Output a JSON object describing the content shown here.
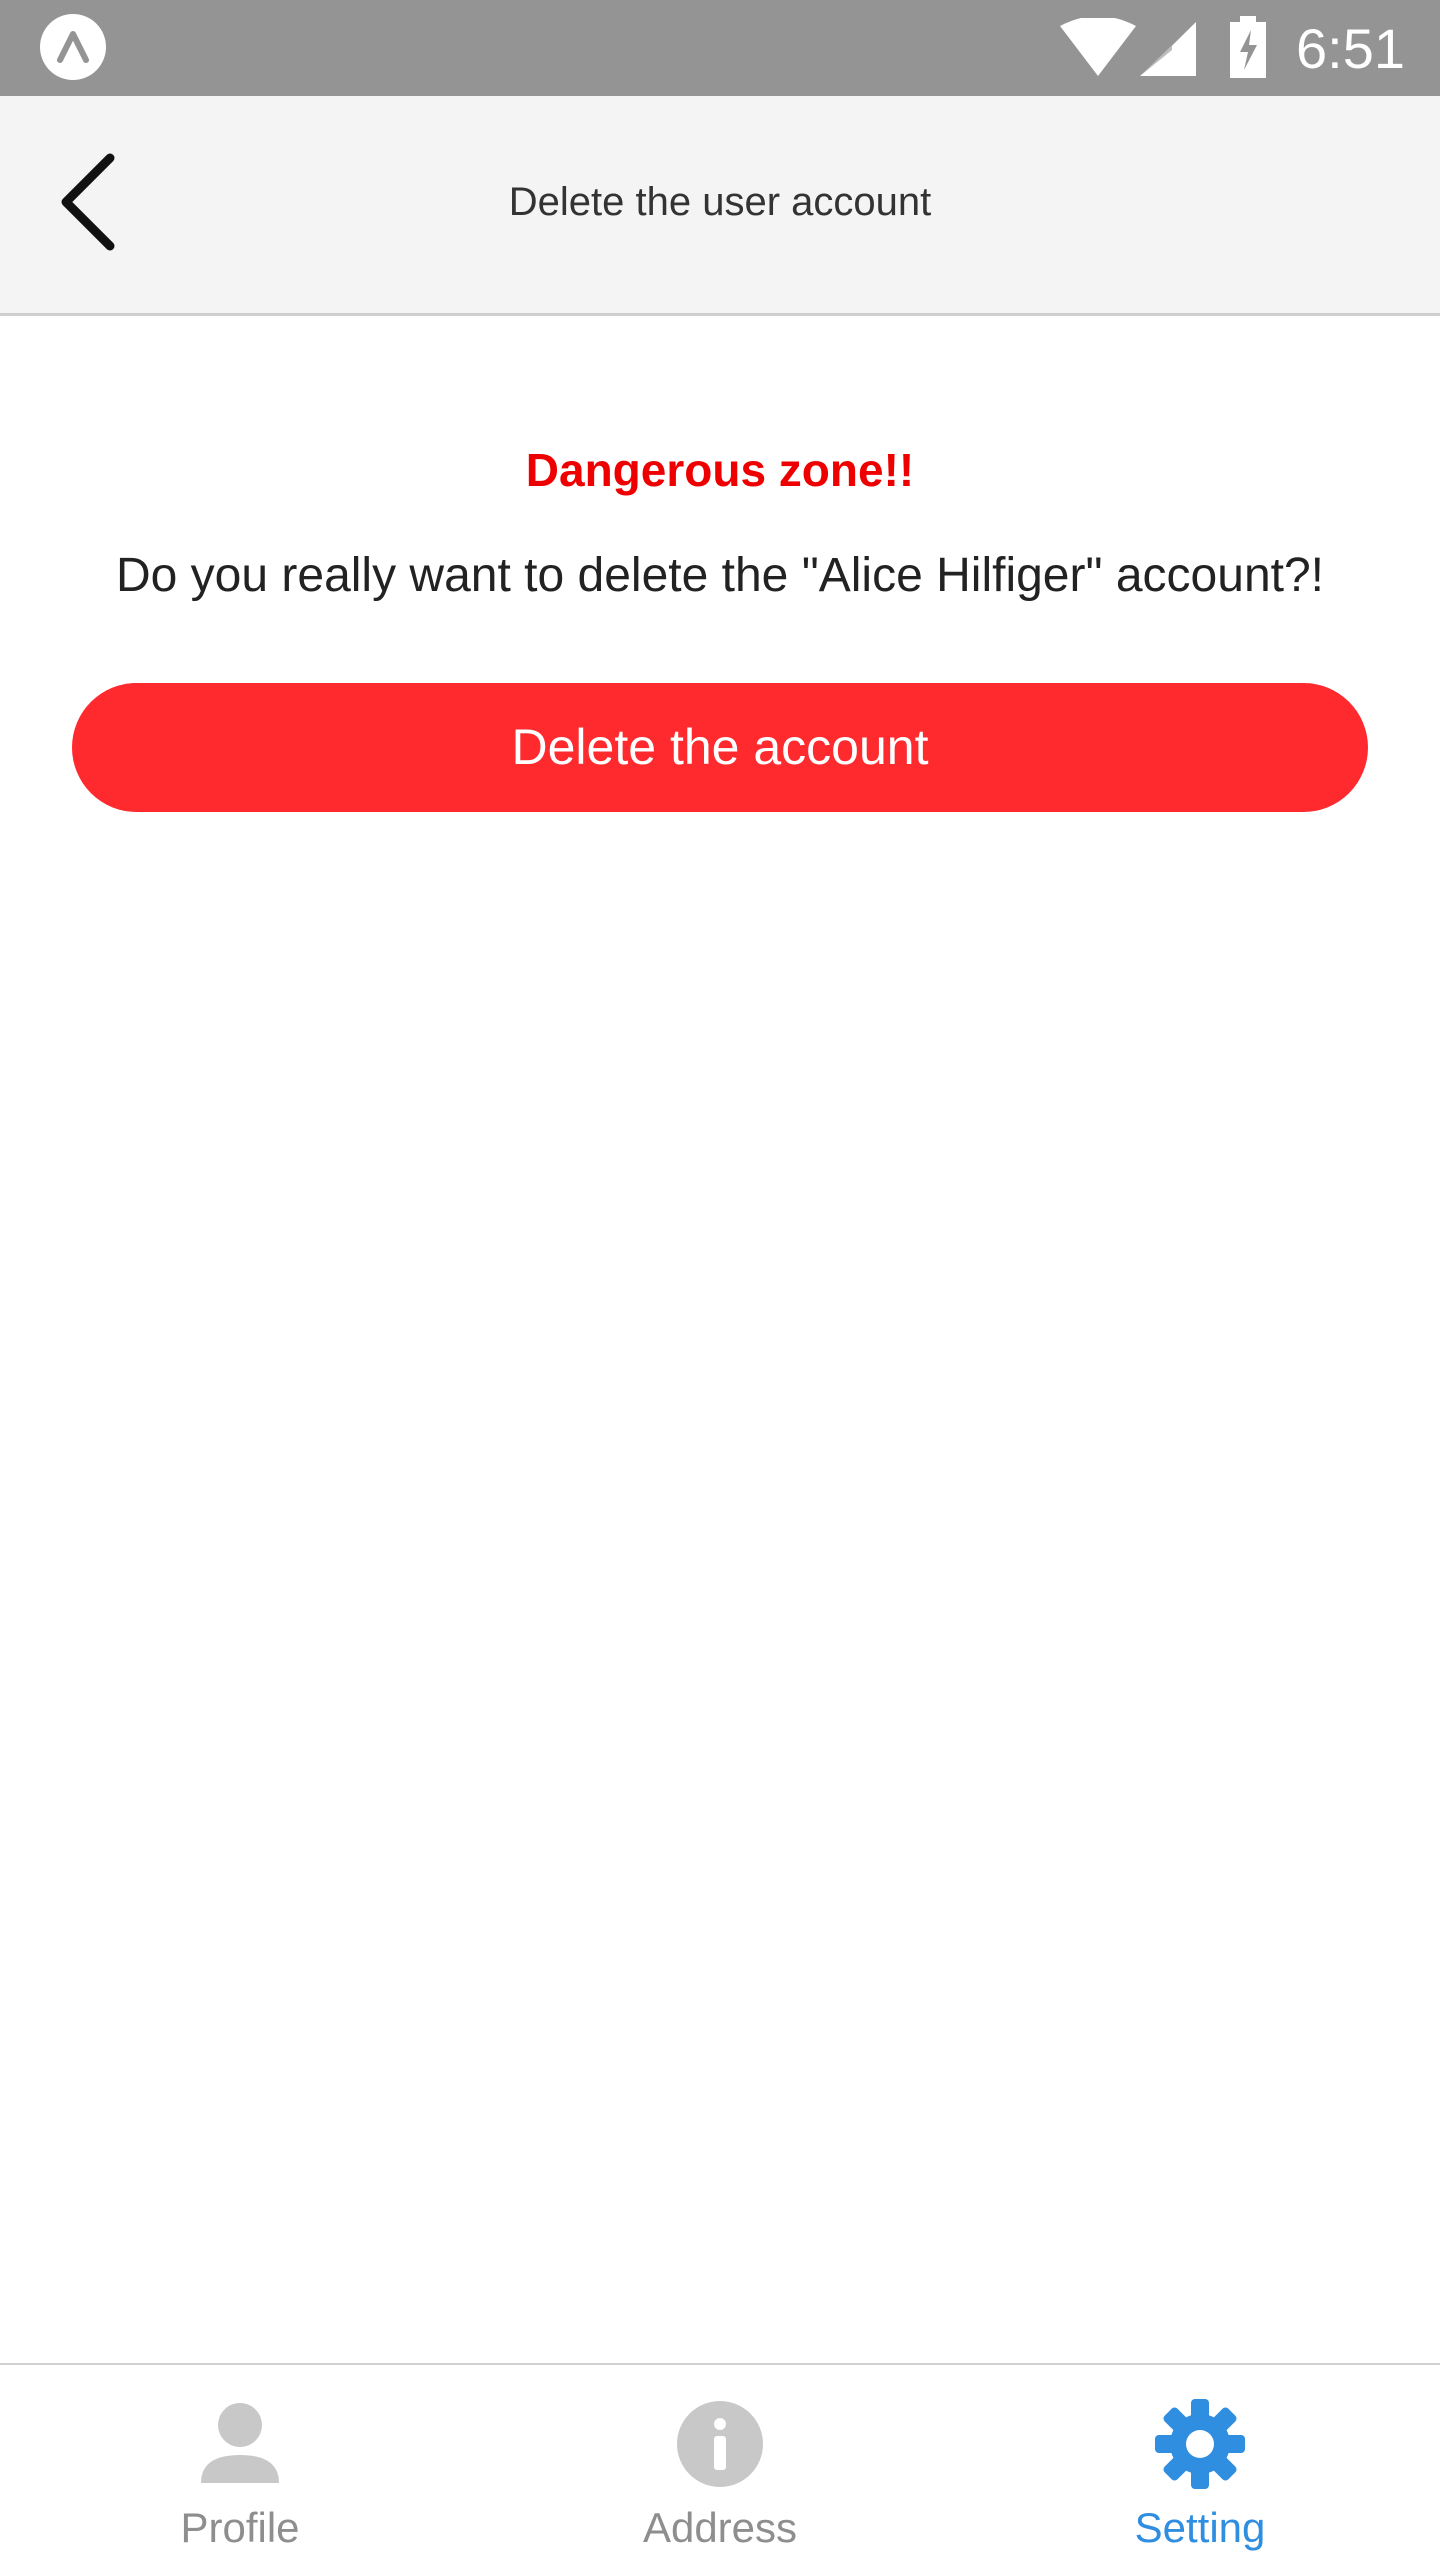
{
  "status_bar": {
    "time": "6:51",
    "icons": [
      "app-icon",
      "wifi-icon",
      "signal-icon",
      "battery-charging-icon"
    ]
  },
  "header": {
    "title": "Delete the user account",
    "back_icon": "chevron-left-icon"
  },
  "content": {
    "danger_title": "Dangerous zone!!",
    "confirm_text": "Do you really want to delete the \"Alice Hilfiger\" account?!",
    "delete_button_label": "Delete the account"
  },
  "bottom_nav": {
    "tabs": [
      {
        "label": "Profile",
        "icon": "person-icon",
        "active": false
      },
      {
        "label": "Address",
        "icon": "info-icon",
        "active": false
      },
      {
        "label": "Setting",
        "icon": "gear-icon",
        "active": true
      }
    ]
  },
  "colors": {
    "status_bar": "#949494",
    "header_bg": "#f4f4f4",
    "danger": "#ee0000",
    "delete_button": "#ff2a2e",
    "active_tab": "#2f8ee0",
    "inactive_tab": "#8e8e8e",
    "inactive_icon": "#c8c8c8"
  }
}
